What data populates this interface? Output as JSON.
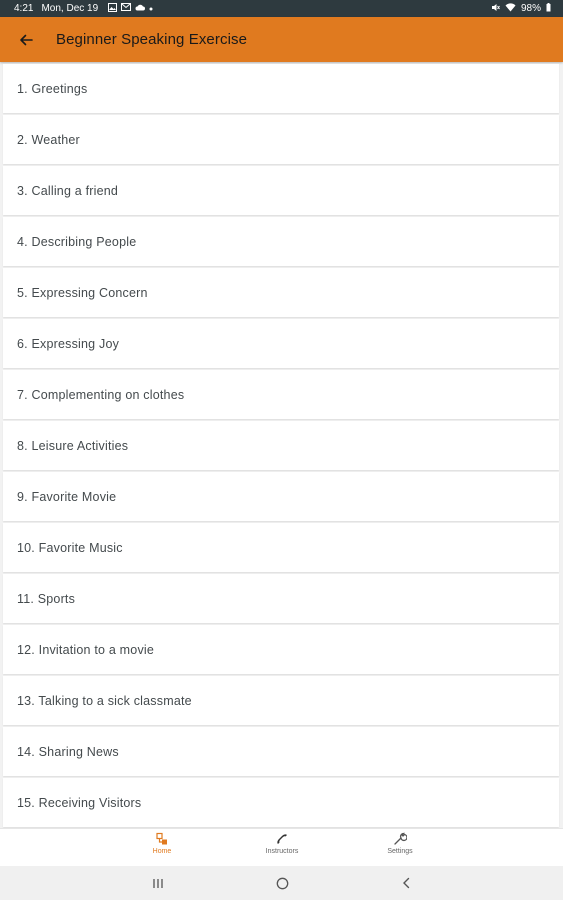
{
  "status_bar": {
    "time": "4:21",
    "date": "Mon, Dec 19",
    "battery": "98%"
  },
  "app_bar": {
    "title": "Beginner Speaking Exercise"
  },
  "lessons": [
    {
      "label": "1. Greetings"
    },
    {
      "label": "2. Weather"
    },
    {
      "label": "3. Calling a friend"
    },
    {
      "label": "4. Describing People"
    },
    {
      "label": "5. Expressing Concern"
    },
    {
      "label": "6. Expressing Joy"
    },
    {
      "label": "7. Complementing on clothes"
    },
    {
      "label": "8. Leisure Activities"
    },
    {
      "label": "9. Favorite Movie"
    },
    {
      "label": "10. Favorite Music"
    },
    {
      "label": "11. Sports"
    },
    {
      "label": "12. Invitation to a movie"
    },
    {
      "label": "13. Talking to a sick classmate"
    },
    {
      "label": "14. Sharing News"
    },
    {
      "label": "15. Receiving Visitors"
    }
  ],
  "bottom_nav": {
    "home": "Home",
    "instructors": "Instructors",
    "settings": "Settings"
  },
  "colors": {
    "accent": "#e07a1f",
    "status_bar": "#2e3a3f"
  }
}
